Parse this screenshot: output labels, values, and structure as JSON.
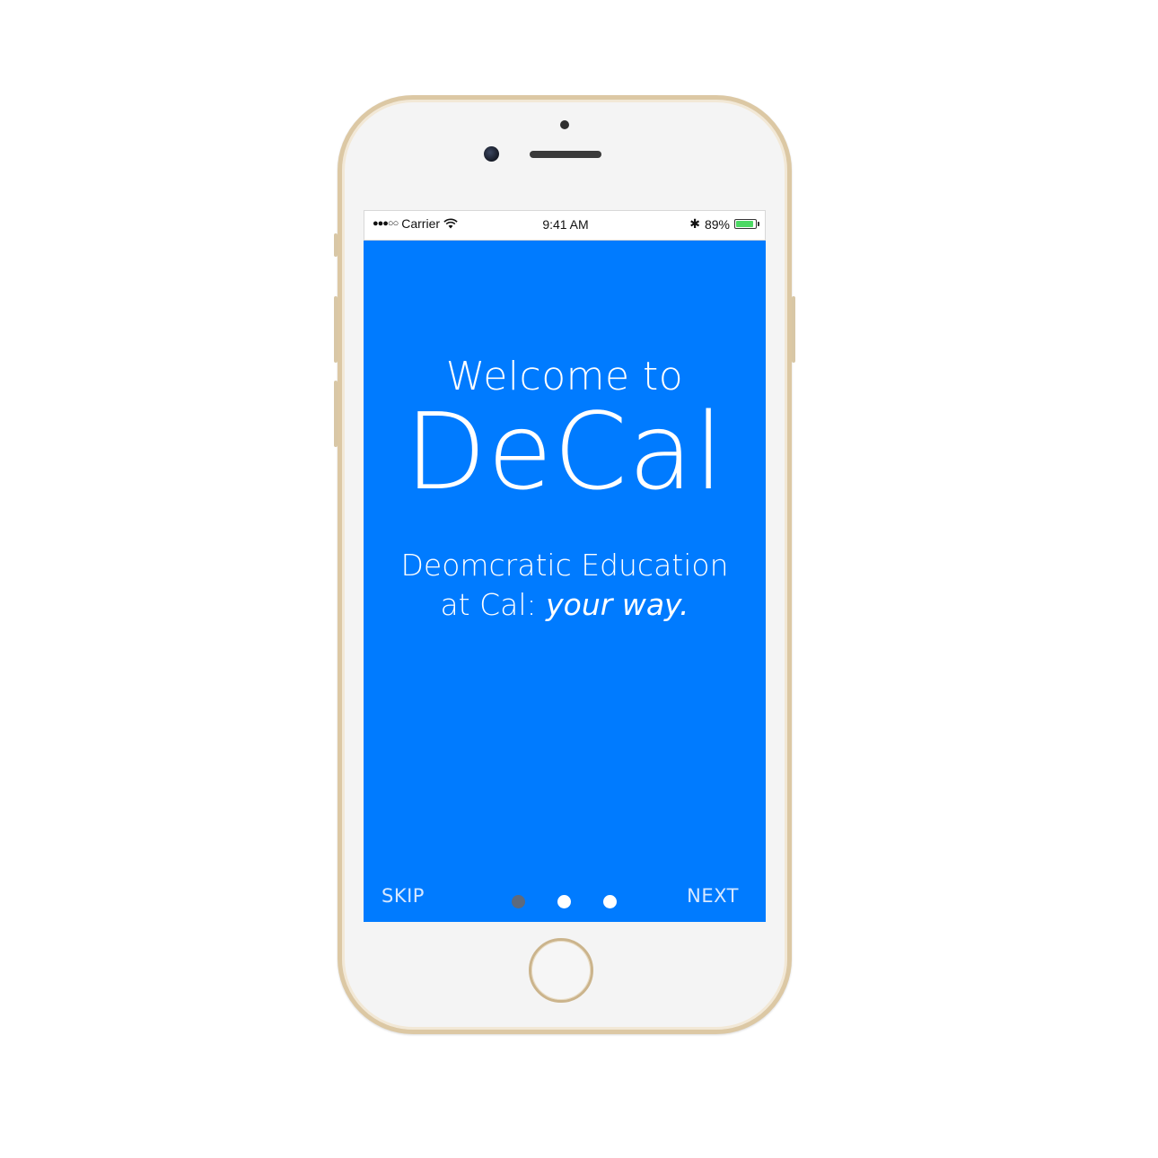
{
  "status_bar": {
    "signal": "●●●○○",
    "carrier": "Carrier",
    "time": "9:41 AM",
    "bluetooth": "✱",
    "battery_percent": "89%",
    "battery_level": 0.89,
    "battery_color": "#4cd964"
  },
  "onboarding": {
    "welcome": "Welcome to",
    "brand": "DeCal",
    "tagline_line1": "Deomcratic Education",
    "tagline_line2_prefix": "at Cal: ",
    "tagline_line2_emphasis": "your way.",
    "skip_label": "SKIP",
    "next_label": "NEXT",
    "page_count": 3,
    "current_page": 1,
    "background_color": "#007bff"
  }
}
